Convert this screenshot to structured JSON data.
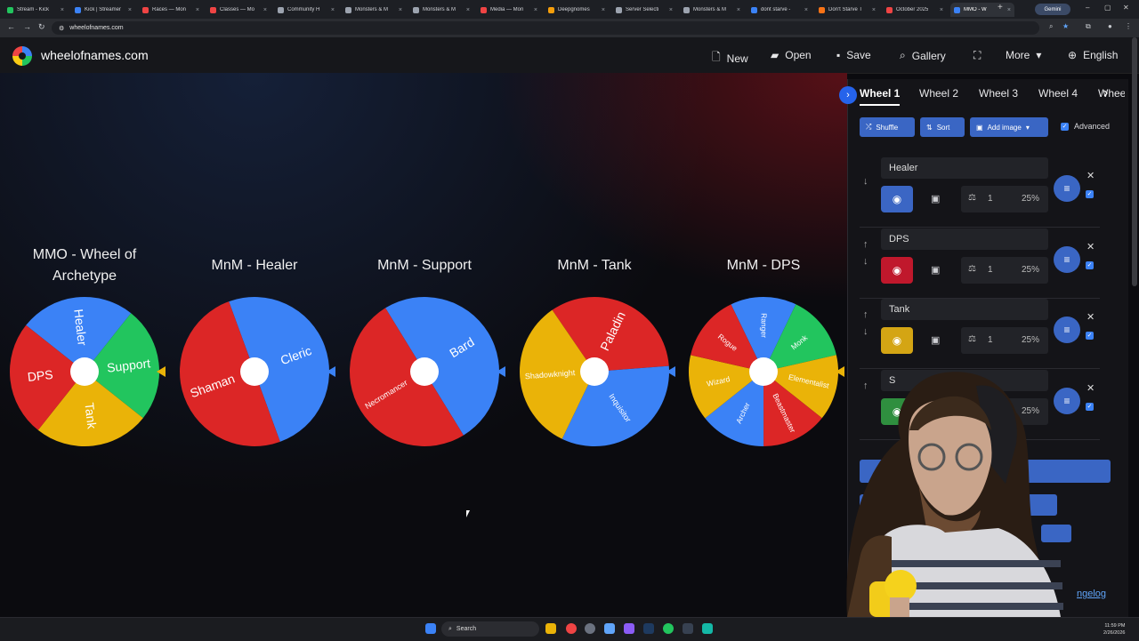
{
  "browser": {
    "tabs": [
      {
        "label": "Stream - Kick",
        "color": "#22c55e"
      },
      {
        "label": "Kick | Streamer",
        "color": "#3b82f6"
      },
      {
        "label": "Races — Mon",
        "color": "#ef4444"
      },
      {
        "label": "Classes — Mo",
        "color": "#ef4444"
      },
      {
        "label": "Community H",
        "color": "#9ca3af"
      },
      {
        "label": "Monsters & M",
        "color": "#9ca3af"
      },
      {
        "label": "Monsters & M",
        "color": "#9ca3af"
      },
      {
        "label": "Media — Mon",
        "color": "#ef4444"
      },
      {
        "label": "Deepgnomes",
        "color": "#f59e0b"
      },
      {
        "label": "Server Selecti",
        "color": "#9ca3af"
      },
      {
        "label": "Monsters & M",
        "color": "#9ca3af"
      },
      {
        "label": "dont starve -",
        "color": "#3b82f6"
      },
      {
        "label": "Don't Starve T",
        "color": "#f97316"
      },
      {
        "label": "October 2025",
        "color": "#ef4444"
      },
      {
        "label": "MMO - W",
        "color": "#3b82f6"
      }
    ],
    "gemini_label": "Gemini",
    "url": "wheelofnames.com"
  },
  "site": {
    "name": "wheelofnames.com",
    "menu": {
      "new": "New",
      "open": "Open",
      "save": "Save",
      "gallery": "Gallery",
      "more": "More",
      "language": "English"
    }
  },
  "wheels": [
    {
      "title": "MMO - Wheel of Archetype",
      "segments": [
        {
          "label": "Healer",
          "color": "#3b82f6"
        },
        {
          "label": "Support",
          "color": "#22c55e"
        },
        {
          "label": "Tank",
          "color": "#eab308"
        },
        {
          "label": "DPS",
          "color": "#dc2626"
        }
      ],
      "pointer": "#eab308"
    },
    {
      "title": "MnM - Healer",
      "segments": [
        {
          "label": "Cleric",
          "color": "#3b82f6"
        },
        {
          "label": "Shaman",
          "color": "#dc2626"
        }
      ],
      "pointer": "#3b82f6"
    },
    {
      "title": "MnM - Support",
      "segments": [
        {
          "label": "Bard",
          "color": "#3b82f6"
        },
        {
          "label": "Necromancer",
          "color": "#dc2626"
        }
      ],
      "pointer": "#3b82f6"
    },
    {
      "title": "MnM - Tank",
      "segments": [
        {
          "label": "Paladin",
          "color": "#dc2626"
        },
        {
          "label": "Inquisitor",
          "color": "#3b82f6"
        },
        {
          "label": "Shadowknight",
          "color": "#eab308"
        }
      ],
      "pointer": "#3b82f6"
    },
    {
      "title": "MnM - DPS",
      "segments": [
        {
          "label": "Ranger",
          "color": "#3b82f6"
        },
        {
          "label": "Monk",
          "color": "#22c55e"
        },
        {
          "label": "Elementalist",
          "color": "#eab308"
        },
        {
          "label": "Beastmaster",
          "color": "#dc2626"
        },
        {
          "label": "Archer",
          "color": "#3b82f6"
        },
        {
          "label": "Wizard",
          "color": "#eab308"
        },
        {
          "label": "Rogue",
          "color": "#dc2626"
        }
      ],
      "pointer": "#eab308"
    }
  ],
  "panel": {
    "wheel_tabs": [
      "Wheel 1",
      "Wheel 2",
      "Wheel 3",
      "Wheel 4",
      "Whee"
    ],
    "toolbar": {
      "shuffle": "Shuffle",
      "sort": "Sort",
      "add_image": "Add image",
      "advanced": "Advanced"
    },
    "entries": [
      {
        "name": "Healer",
        "weight": "1",
        "percent": "25%",
        "color": "#3b66c4"
      },
      {
        "name": "DPS",
        "weight": "1",
        "percent": "25%",
        "color": "#c0182c"
      },
      {
        "name": "Tank",
        "weight": "1",
        "percent": "25%",
        "color": "#d4a514"
      },
      {
        "name": "S",
        "weight": "1",
        "percent": "25%",
        "color": "#2f8f3f"
      }
    ],
    "changelog": "ngelog"
  },
  "taskbar": {
    "search": "Search",
    "time": "11:59 PM",
    "date": "2/26/2026"
  }
}
